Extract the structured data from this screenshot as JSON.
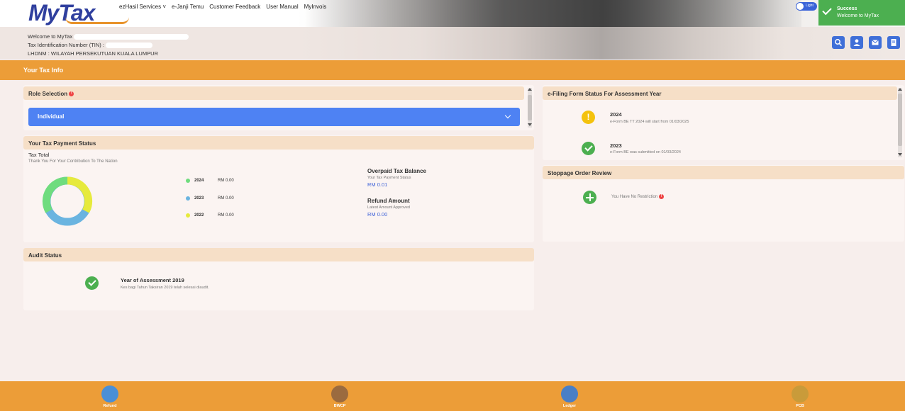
{
  "nav": {
    "logo_my": "My",
    "logo_tax": "Tax",
    "items": [
      "ezHasil Services",
      "e-Janji Temu",
      "Customer Feedback",
      "User Manual",
      "MyInvois"
    ],
    "theme_toggle_label": "Light"
  },
  "toast": {
    "title": "Success",
    "message": "Welcome to MyTax"
  },
  "banner": {
    "welcome_label": "Welcome to MyTax",
    "tin_label": "Tax Identification Number (TIN) :",
    "lhdnm_label": "LHDNM : WILAYAH PERSEKUTUAN KUALA LUMPUR"
  },
  "section_title": "Your Tax Info",
  "role_selection": {
    "title": "Role Selection",
    "selected": "Individual"
  },
  "payment_status": {
    "title": "Your Tax Payment Status",
    "tax_total_label": "Tax Total",
    "thanks": "Thank You For Your Contribution To The Nation",
    "legend": [
      {
        "year": "2024",
        "amount": "RM 0.00",
        "color": "#6fdc7e"
      },
      {
        "year": "2023",
        "amount": "RM 0.00",
        "color": "#6ab4e0"
      },
      {
        "year": "2022",
        "amount": "RM 0.00",
        "color": "#e6ea3c"
      }
    ],
    "overpaid": {
      "title": "Overpaid Tax Balance",
      "subtitle": "Your Tax Payment Status",
      "value": "RM 0.01"
    },
    "refund": {
      "title": "Refund Amount",
      "subtitle": "Latest Amount Approved",
      "value": "RM 0.00"
    }
  },
  "audit": {
    "title": "Audit Status",
    "item_title": "Year of Assessment 2019",
    "item_text": "Kes bagi Tahun Taksiran 2019 telah selesai diaudit."
  },
  "efiling": {
    "title": "e-Filing Form Status For Assessment Year",
    "items": [
      {
        "year": "2024",
        "text": "e-Form BE TT 2024 will start from 01/03/2025"
      },
      {
        "year": "2023",
        "text": "e-Form BE was submitted on 01/03/2024"
      }
    ]
  },
  "stoppage": {
    "title": "Stoppage Order Review",
    "text": "You Have No Restriction"
  },
  "footer": {
    "items": [
      {
        "label": "Refund",
        "color": "#4a8fd6"
      },
      {
        "label": "BWCP",
        "color": "#9b6b3f"
      },
      {
        "label": "Ledger",
        "color": "#4a7fc6"
      },
      {
        "label": "PCB",
        "color": "#c99b3a"
      }
    ]
  },
  "colors": {
    "orange": "#ec9d38",
    "accent_blue": "#4e82f3",
    "success_green": "#4caf50"
  }
}
